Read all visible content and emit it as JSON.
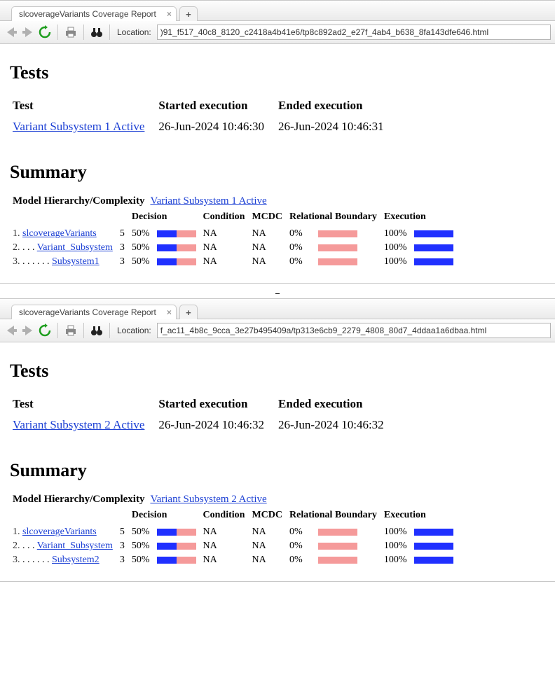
{
  "windows": [
    {
      "tab_title": "slcoverageVariants Coverage Report",
      "location_label": "Location:",
      "location_value": ")91_f517_40c8_8120_c2418a4b41e6/tp8c892ad2_e27f_4ab4_b638_8fa143dfe646.html",
      "tests_heading": "Tests",
      "tests_header": {
        "test": "Test",
        "started": "Started execution",
        "ended": "Ended execution"
      },
      "tests_row": {
        "name": "Variant Subsystem 1 Active",
        "started": "26-Jun-2024 10:46:30",
        "ended": "26-Jun-2024 10:46:31"
      },
      "summary_heading": "Summary",
      "summary_label": "Model Hierarchy/Complexity",
      "summary_link": "Variant Subsystem 1 Active",
      "cols": {
        "decision": "Decision",
        "condition": "Condition",
        "mcdc": "MCDC",
        "relbound": "Relational Boundary",
        "execution": "Execution"
      },
      "rows": [
        {
          "num": "1.",
          "indent": "",
          "name": "slcoverageVariants",
          "cx": "5",
          "decision": "50%",
          "decision_fill": 50,
          "condition": "NA",
          "mcdc": "NA",
          "relbound": "0%",
          "relbound_fill": 0,
          "execution": "100%",
          "execution_fill": 100
        },
        {
          "num": "2.",
          "indent": ". . . ",
          "name": "Variant_Subsystem",
          "cx": "3",
          "decision": "50%",
          "decision_fill": 50,
          "condition": "NA",
          "mcdc": "NA",
          "relbound": "0%",
          "relbound_fill": 0,
          "execution": "100%",
          "execution_fill": 100
        },
        {
          "num": "3.",
          "indent": ". . . . . . ",
          "name": "Subsystem1",
          "cx": "3",
          "decision": "50%",
          "decision_fill": 50,
          "condition": "NA",
          "mcdc": "NA",
          "relbound": "0%",
          "relbound_fill": 0,
          "execution": "100%",
          "execution_fill": 100
        }
      ]
    },
    {
      "tab_title": "slcoverageVariants Coverage Report",
      "location_label": "Location:",
      "location_value": "f_ac11_4b8c_9cca_3e27b495409a/tp313e6cb9_2279_4808_80d7_4ddaa1a6dbaa.html",
      "tests_heading": "Tests",
      "tests_header": {
        "test": "Test",
        "started": "Started execution",
        "ended": "Ended execution"
      },
      "tests_row": {
        "name": "Variant Subsystem 2 Active",
        "started": "26-Jun-2024 10:46:32",
        "ended": "26-Jun-2024 10:46:32"
      },
      "summary_heading": "Summary",
      "summary_label": "Model Hierarchy/Complexity",
      "summary_link": "Variant Subsystem 2 Active",
      "cols": {
        "decision": "Decision",
        "condition": "Condition",
        "mcdc": "MCDC",
        "relbound": "Relational Boundary",
        "execution": "Execution"
      },
      "rows": [
        {
          "num": "1.",
          "indent": "",
          "name": "slcoverageVariants",
          "cx": "5",
          "decision": "50%",
          "decision_fill": 50,
          "condition": "NA",
          "mcdc": "NA",
          "relbound": "0%",
          "relbound_fill": 0,
          "execution": "100%",
          "execution_fill": 100
        },
        {
          "num": "2.",
          "indent": ". . . ",
          "name": "Variant_Subsystem",
          "cx": "3",
          "decision": "50%",
          "decision_fill": 50,
          "condition": "NA",
          "mcdc": "NA",
          "relbound": "0%",
          "relbound_fill": 0,
          "execution": "100%",
          "execution_fill": 100
        },
        {
          "num": "3.",
          "indent": ". . . . . . ",
          "name": "Subsystem2",
          "cx": "3",
          "decision": "50%",
          "decision_fill": 50,
          "condition": "NA",
          "mcdc": "NA",
          "relbound": "0%",
          "relbound_fill": 0,
          "execution": "100%",
          "execution_fill": 100
        }
      ]
    }
  ],
  "icons": {
    "newtab": "+",
    "close": "×"
  }
}
